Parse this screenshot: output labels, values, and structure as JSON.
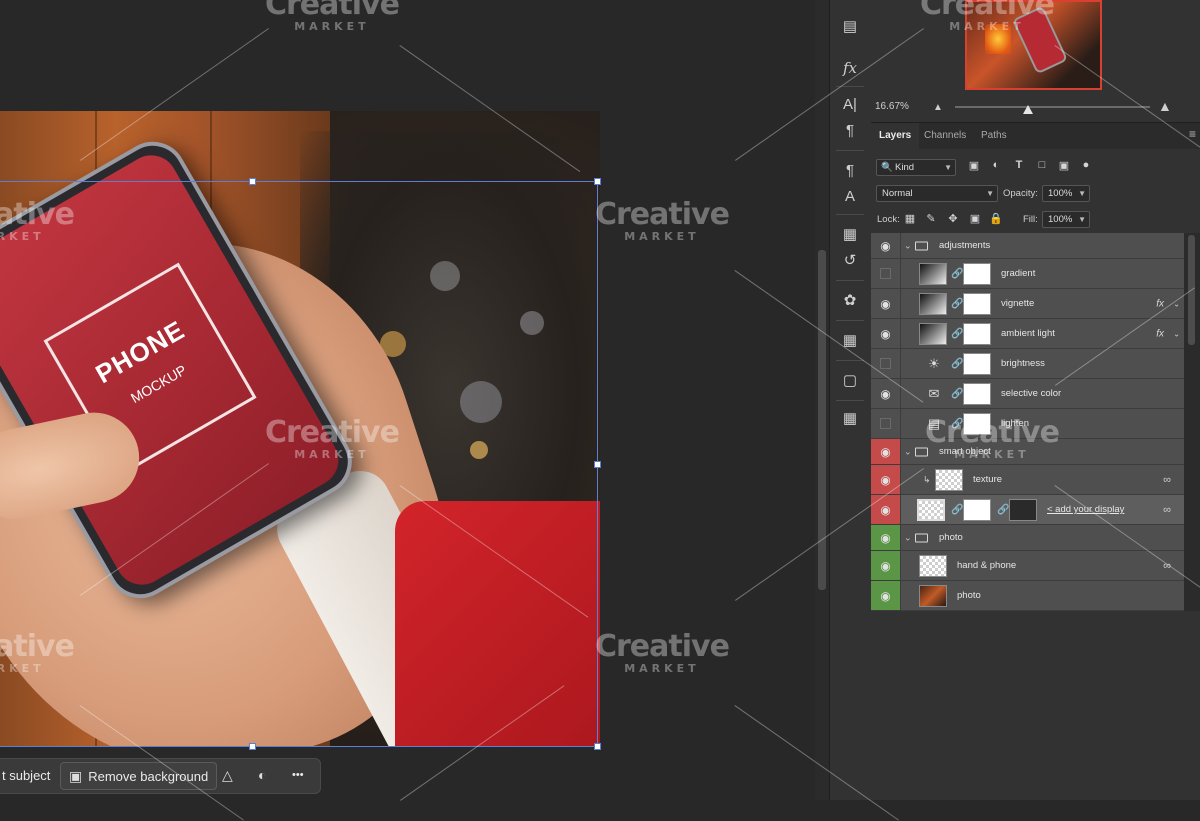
{
  "canvas": {
    "screen_title": "PHONE",
    "screen_subtitle": "MOCKUP"
  },
  "taskbar": {
    "select_subject_label": "t subject",
    "remove_background_label": "Remove background",
    "more_label": "•••"
  },
  "navigator": {
    "zoom": "16.67%"
  },
  "panel_tabs": [
    "Layers",
    "Channels",
    "Paths"
  ],
  "filter": {
    "kind_label": "Kind"
  },
  "blend": {
    "mode": "Normal",
    "opacity_label": "Opacity:",
    "opacity_value": "100%"
  },
  "lock": {
    "label": "Lock:",
    "fill_label": "Fill:",
    "fill_value": "100%"
  },
  "layers": [
    {
      "name": "adjustments",
      "type": "group",
      "visible": true
    },
    {
      "name": "gradient",
      "visible": false
    },
    {
      "name": "vignette",
      "visible": true,
      "fx": "fx"
    },
    {
      "name": "ambient light",
      "visible": true,
      "fx": "fx"
    },
    {
      "name": "brightness",
      "visible": false
    },
    {
      "name": "selective color",
      "visible": true
    },
    {
      "name": "lighten",
      "visible": false
    },
    {
      "name": "smart object",
      "type": "group",
      "visible": true,
      "color": "#c54a4a"
    },
    {
      "name": "texture",
      "visible": true,
      "color": "#c54a4a"
    },
    {
      "name": "< add your display",
      "visible": true,
      "color": "#c54a4a",
      "selected": true
    },
    {
      "name": "photo",
      "type": "group",
      "visible": true,
      "color": "#5b9546"
    },
    {
      "name": "hand & phone",
      "visible": true,
      "color": "#5b9546"
    },
    {
      "name": "photo",
      "visible": true,
      "color": "#5b9546"
    }
  ],
  "watermark": {
    "line1": "Creative",
    "line2": "MARKET"
  }
}
